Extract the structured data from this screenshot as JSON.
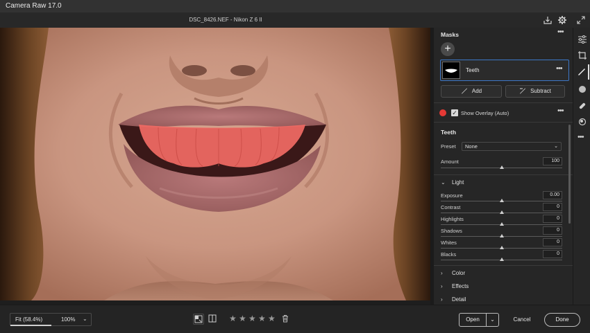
{
  "app": {
    "title": "Camera Raw 17.0"
  },
  "file": {
    "label": "DSC_8426.NEF  -  Nikon Z 6 II"
  },
  "masks": {
    "header": "Masks",
    "items": [
      {
        "name": "Teeth"
      }
    ],
    "add_label": "Add",
    "subtract_label": "Subtract",
    "show_overlay_label": "Show Overlay (Auto)",
    "show_overlay_checked": true,
    "overlay_color": "#e53935"
  },
  "adjust": {
    "title": "Teeth",
    "preset_label": "Preset",
    "preset_value": "None",
    "amount_label": "Amount",
    "amount_value": "100",
    "amount_level": 0.5,
    "light_section": "Light",
    "light_sliders": [
      {
        "label": "Exposure",
        "value": "0.00",
        "level": 0.5
      },
      {
        "label": "Contrast",
        "value": "0",
        "level": 0.5
      },
      {
        "label": "Highlights",
        "value": "0",
        "level": 0.5
      },
      {
        "label": "Shadows",
        "value": "0",
        "level": 0.5
      },
      {
        "label": "Whites",
        "value": "0",
        "level": 0.5
      },
      {
        "label": "Blacks",
        "value": "0",
        "level": 0.5
      }
    ],
    "collapsed_sections": [
      "Color",
      "Effects",
      "Detail"
    ]
  },
  "bottom": {
    "zoom_fit": "Fit (58.4%)",
    "zoom_pct": "100%",
    "rating_stars": 5,
    "open_label": "Open",
    "cancel_label": "Cancel",
    "done_label": "Done"
  },
  "icons": {
    "titlebar": [
      "save-icon",
      "gear-icon",
      "expand-icon"
    ],
    "toolstrip": [
      "edit-sliders-icon",
      "crop-icon",
      "masking-brush-icon",
      "circle-icon",
      "healing-icon",
      "red-eye-icon",
      "more-icon"
    ]
  }
}
